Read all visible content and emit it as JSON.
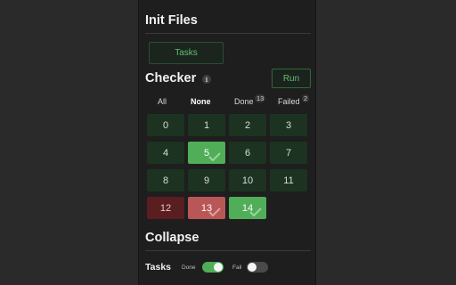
{
  "init_files": {
    "title": "Init Files",
    "tasks_button": "Tasks"
  },
  "checker": {
    "title": "Checker",
    "info_icon": "i",
    "run_button": "Run",
    "filters": [
      {
        "label": "All",
        "count": null,
        "active": false
      },
      {
        "label": "None",
        "count": null,
        "active": true
      },
      {
        "label": "Done",
        "count": "13",
        "active": false
      },
      {
        "label": "Failed",
        "count": "2",
        "active": false
      }
    ],
    "tiles": [
      {
        "label": "0",
        "status": "pending"
      },
      {
        "label": "1",
        "status": "pending"
      },
      {
        "label": "2",
        "status": "pending"
      },
      {
        "label": "3",
        "status": "pending"
      },
      {
        "label": "4",
        "status": "pending"
      },
      {
        "label": "5",
        "status": "success"
      },
      {
        "label": "6",
        "status": "pending"
      },
      {
        "label": "7",
        "status": "pending"
      },
      {
        "label": "8",
        "status": "pending"
      },
      {
        "label": "9",
        "status": "pending"
      },
      {
        "label": "10",
        "status": "pending"
      },
      {
        "label": "11",
        "status": "pending"
      },
      {
        "label": "12",
        "status": "failed-dim"
      },
      {
        "label": "13",
        "status": "failed"
      },
      {
        "label": "14",
        "status": "success"
      }
    ]
  },
  "collapse": {
    "title": "Collapse",
    "tasks_label": "Tasks",
    "done_label": "Done",
    "done_toggle": "on",
    "fail_label": "Fail",
    "fail_toggle": "off"
  },
  "colors": {
    "accent": "#4fae57",
    "failed": "#b95656",
    "tile_bg": "#1c3321",
    "panel_bg": "#1e1e1e"
  }
}
